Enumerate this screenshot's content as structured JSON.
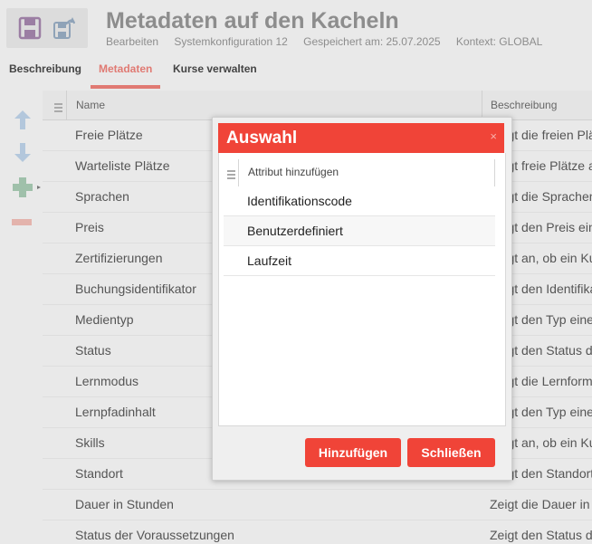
{
  "header": {
    "title": "Metadaten auf den Kacheln",
    "meta": {
      "mode": "Bearbeiten",
      "config": "Systemkonfiguration 12",
      "saved": "Gespeichert am: 25.07.2025",
      "context": "Kontext: GLOBAL"
    },
    "icons": [
      "save-icon",
      "save-as-icon"
    ]
  },
  "tabs": [
    {
      "label": "Beschreibung"
    },
    {
      "label": "Metadaten",
      "active": true
    },
    {
      "label": "Kurse verwalten"
    }
  ],
  "toolbar": {
    "icons": [
      "arrow-up-icon",
      "arrow-down-icon",
      "add-icon",
      "remove-icon"
    ]
  },
  "table": {
    "headers": {
      "name": "Name",
      "description": "Beschreibung"
    },
    "rows": [
      {
        "name": "Freie Plätze",
        "description": "Zeigt die freien Plä"
      },
      {
        "name": "Warteliste Plätze",
        "description": "Zeigt freie Plätze a"
      },
      {
        "name": "Sprachen",
        "description": "Zeigt die Sprachen"
      },
      {
        "name": "Preis",
        "description": "Zeigt den Preis ein"
      },
      {
        "name": "Zertifizierungen",
        "description": "Zeigt an, ob ein Ku"
      },
      {
        "name": "Buchungsidentifikator",
        "description": "Zeigt den Identifika"
      },
      {
        "name": "Medientyp",
        "description": "Zeigt den Typ eine"
      },
      {
        "name": "Status",
        "description": "Zeigt den Status d"
      },
      {
        "name": "Lernmodus",
        "description": "Zeigt die Lernform"
      },
      {
        "name": "Lernpfadinhalt",
        "description": "Zeigt den Typ eine"
      },
      {
        "name": "Skills",
        "description": "Zeigt an, ob ein Ku"
      },
      {
        "name": "Standort",
        "description": "Zeigt den Standort"
      },
      {
        "name": "Dauer in Stunden",
        "description": "Zeigt die Dauer in"
      },
      {
        "name": "Status der Voraussetzungen",
        "description": "Zeigt den Status d"
      }
    ]
  },
  "modal": {
    "title": "Auswahl",
    "close_glyph": "×",
    "list_header": "Attribut hinzufügen",
    "items": [
      "Identifikationscode",
      "Benutzerdefiniert",
      "Laufzeit"
    ],
    "buttons": {
      "add": "Hinzufügen",
      "close": "Schließen"
    }
  },
  "colors": {
    "accent": "#f04438",
    "tab_active": "#e07a73",
    "header_text": "#8d8d8d"
  }
}
